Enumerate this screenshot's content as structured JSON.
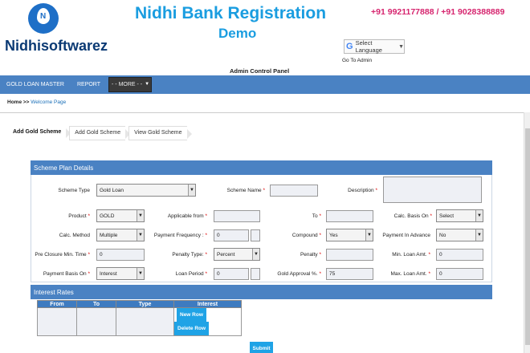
{
  "header": {
    "brand": "Nidhisoftwarez",
    "title_line1": "Nidhi Bank Registration",
    "title_line2": "Demo",
    "phones": "+91 9921177888 / +91 9028388889",
    "language_selector": "Select Language",
    "go_to_admin": "Go To Admin",
    "admin_control_panel": "Admin Control Panel"
  },
  "nav": {
    "items": [
      "GOLD LOAN MASTER",
      "REPORT"
    ],
    "more_select": "- - MORE - -"
  },
  "breadcrumb": {
    "home": "Home >>",
    "page": "Welcome Page"
  },
  "tabs": [
    "Add Gold Scheme",
    "Add Gold Scheme",
    "View Gold Scheme"
  ],
  "scheme_panel": {
    "title": "Scheme Plan Details",
    "scheme_type_label": "Scheme Type",
    "scheme_type_value": "Gold Loan",
    "scheme_name_label": "Scheme Name",
    "description_label": "Description",
    "product_label": "Product",
    "product_value": "GOLD",
    "applicable_from_label": "Applicable from",
    "to_label": "To",
    "calc_basis_on_label": "Calc. Basis On",
    "calc_basis_on_value": "Select",
    "calc_method_label": "Calc. Method",
    "calc_method_value": "Multiple",
    "payment_frequency_label": "Payment Frequency :",
    "payment_frequency_value": "0",
    "compound_label": "Compound",
    "compound_value": "Yes",
    "payment_in_advance_label": "Payment In Advance",
    "payment_in_advance_value": "No",
    "pre_closure_label": "Pre Closure Min. Time",
    "pre_closure_value": "0",
    "penalty_type_label": "Penalty Type:",
    "penalty_type_value": "Percent",
    "penalty_label": "Penalty",
    "min_loan_amt_label": "Min. Loan Amt.",
    "min_loan_amt_value": "0",
    "payment_basis_on_label": "Payment Basis On",
    "payment_basis_on_value": "Interest",
    "loan_period_label": "Loan Period",
    "loan_period_value": "0",
    "gold_approval_label": "Gold Approval %.",
    "gold_approval_value": "75",
    "max_loan_amt_label": "Max. Loan Amt.",
    "max_loan_amt_value": "0",
    "required_mark": "*"
  },
  "interest_panel": {
    "title": "Interest Rates",
    "columns": [
      "From",
      "To",
      "Type",
      "Interest"
    ],
    "new_row": "New Row",
    "delete_row": "Delete Row"
  },
  "submit": "Submit",
  "colors": {
    "nav_blue": "#4a82c3",
    "title_blue": "#1a9de0",
    "phone_pink": "#d6246e",
    "button_blue": "#1fa3e6"
  }
}
